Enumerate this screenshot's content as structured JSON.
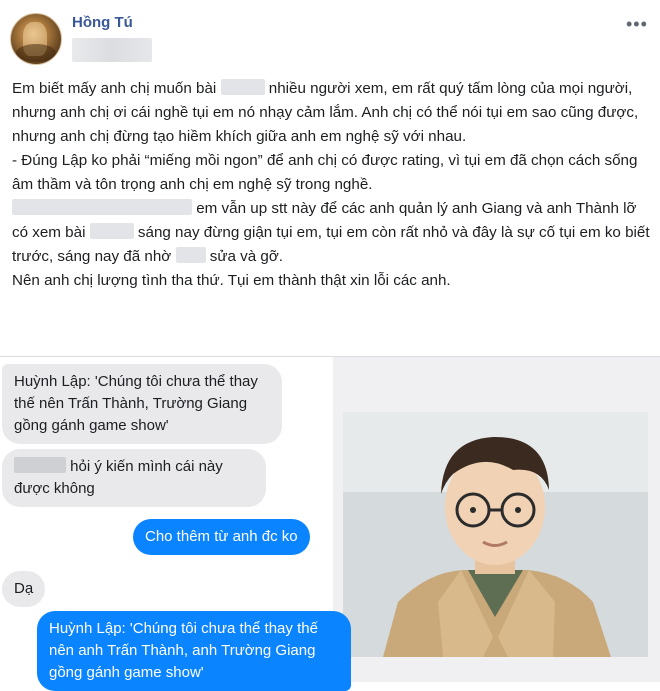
{
  "post": {
    "author": "Hồng Tú",
    "more_label": "•••",
    "paragraph_1a": "Em biết mấy anh chị muốn bài",
    "paragraph_1b": " nhiều người xem, em rất quý tấm lòng của mọi người, nhưng anh chị ơi cái nghề tụi em nó nhạy cảm lắm. Anh chị có thể nói tụi em sao cũng được, nhưng anh chị đừng tạo hiềm khích giữa anh em nghệ sỹ với nhau.",
    "paragraph_2": "- Đúng Lập ko phải “miếng mồi ngon” để anh chị có được rating, vì tụi em đã chọn cách sống âm thầm và tôn trọng anh chị em nghệ sỹ trong nghề.",
    "paragraph_3a": "em vẫn up stt này để các anh quản lý anh Giang và anh Thành lỡ có xem bài",
    "paragraph_3b": " sáng nay đừng giận tụi em, tụi em còn rất nhỏ và đây là sự cố tụi em ko biết trước, sáng nay đã nhờ",
    "paragraph_3c": " sửa và gỡ.",
    "paragraph_4": "Nên anh chị lượng tình tha thứ. Tụi em thành thật xin lỗi các anh."
  },
  "chat": {
    "msg_1": "Huỳnh Lập: 'Chúng tôi chưa thể thay thế nên Trấn Thành, Trường Giang gồng gánh game show'",
    "msg_2": "hỏi ý kiến mình cái này được không",
    "msg_3": "Cho thêm từ anh đc ko",
    "msg_4": "Dạ",
    "msg_5": "Huỳnh Lập: 'Chúng tôi chưa thể thay thế nên anh Trấn Thành, anh Trường Giang gồng gánh game show'"
  },
  "colors": {
    "author": "#385898",
    "bubble_incoming": "#e9e9eb",
    "bubble_outgoing": "#0a84ff"
  }
}
